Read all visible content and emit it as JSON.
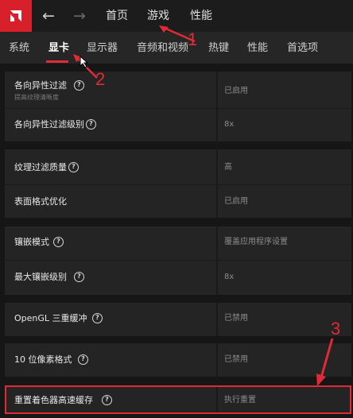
{
  "header": {
    "back_icon": "arrow-left-icon",
    "forward_icon": "arrow-right-icon",
    "tabs": [
      {
        "label": "首页"
      },
      {
        "label": "游戏"
      },
      {
        "label": "性能"
      }
    ]
  },
  "subtabs": [
    {
      "label": "系统"
    },
    {
      "label": "显卡",
      "active": true
    },
    {
      "label": "显示器"
    },
    {
      "label": "音频和视频"
    },
    {
      "label": "热键"
    },
    {
      "label": "性能"
    },
    {
      "label": "首选项"
    }
  ],
  "settings": [
    {
      "label": "各向异性过滤",
      "sublabel": "提高纹理清晰度",
      "value": "已启用"
    },
    {
      "label": "各向异性过滤级别",
      "value": "8x"
    },
    {
      "label": "纹理过滤质量",
      "value": "高"
    },
    {
      "label": "表面格式优化",
      "value": "已启用"
    },
    {
      "label": "镶嵌模式",
      "value": "覆盖应用程序设置"
    },
    {
      "label": "最大镶嵌级别",
      "value": "8x"
    },
    {
      "label": "OpenGL 三重缓冲",
      "value": "已禁用"
    },
    {
      "label": "10 位像素格式",
      "value": "已禁用"
    },
    {
      "label": "重置着色器高速缓存",
      "value": "执行重置"
    }
  ],
  "annotations": [
    "1",
    "2",
    "3"
  ],
  "colors": {
    "accent": "#e02b36",
    "logo": "#d8202a"
  }
}
